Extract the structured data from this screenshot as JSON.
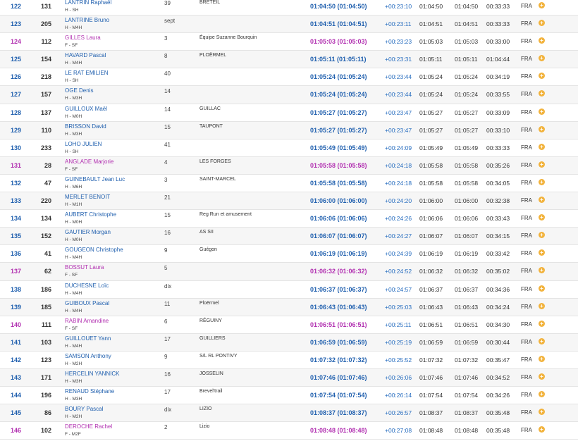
{
  "colors": {
    "male": "#1f5fae",
    "female": "#b12fb0",
    "gap": "#2a6fc0",
    "add_button": "#f2b33d"
  },
  "add_icon": "plus-circle-icon",
  "rows": [
    {
      "rank": "122",
      "bib": "131",
      "name": "LANTRIN Raphaël",
      "cat": "H - SH",
      "age": "39",
      "club": "BRETEIL",
      "time": "01:04:50 (01:04:50)",
      "gap": "+00:23:10",
      "t1": "01:04:50",
      "t2": "01:04:50",
      "t3": "00:33:33",
      "nat": "FRA",
      "sex": "m",
      "add": "+"
    },
    {
      "rank": "123",
      "bib": "205",
      "name": "LANTRINE Bruno",
      "cat": "H - M4H",
      "age": "sept",
      "club": "",
      "time": "01:04:51 (01:04:51)",
      "gap": "+00:23:11",
      "t1": "01:04:51",
      "t2": "01:04:51",
      "t3": "00:33:33",
      "nat": "FRA",
      "sex": "m",
      "add": "+"
    },
    {
      "rank": "124",
      "bib": "112",
      "name": "GILLES Laura",
      "cat": "F - SF",
      "age": "3",
      "club": "Équipe Suzanne Bourquin",
      "time": "01:05:03 (01:05:03)",
      "gap": "+00:23:23",
      "t1": "01:05:03",
      "t2": "01:05:03",
      "t3": "00:33:00",
      "nat": "FRA",
      "sex": "f",
      "add": "+"
    },
    {
      "rank": "125",
      "bib": "154",
      "name": "HAVARD Pascal",
      "cat": "H - M4H",
      "age": "8",
      "club": "PLOËRMEL",
      "time": "01:05:11 (01:05:11)",
      "gap": "+00:23:31",
      "t1": "01:05:11",
      "t2": "01:05:11",
      "t3": "01:04:44",
      "nat": "FRA",
      "sex": "m",
      "add": "+"
    },
    {
      "rank": "126",
      "bib": "218",
      "name": "LE RAT EMILIEN",
      "cat": "H - SH",
      "age": "40",
      "club": "",
      "time": "01:05:24 (01:05:24)",
      "gap": "+00:23:44",
      "t1": "01:05:24",
      "t2": "01:05:24",
      "t3": "00:34:19",
      "nat": "FRA",
      "sex": "m",
      "add": "+"
    },
    {
      "rank": "127",
      "bib": "157",
      "name": "OGE Denis",
      "cat": "H - M3H",
      "age": "14",
      "club": "",
      "time": "01:05:24 (01:05:24)",
      "gap": "+00:23:44",
      "t1": "01:05:24",
      "t2": "01:05:24",
      "t3": "00:33:55",
      "nat": "FRA",
      "sex": "m",
      "add": "+"
    },
    {
      "rank": "128",
      "bib": "137",
      "name": "GUILLOUX Maël",
      "cat": "H - M0H",
      "age": "14",
      "club": "GUILLAC",
      "time": "01:05:27 (01:05:27)",
      "gap": "+00:23:47",
      "t1": "01:05:27",
      "t2": "01:05:27",
      "t3": "00:33:09",
      "nat": "FRA",
      "sex": "m",
      "add": "+"
    },
    {
      "rank": "129",
      "bib": "110",
      "name": "BRISSON David",
      "cat": "H - M3H",
      "age": "15",
      "club": "TAUPONT",
      "time": "01:05:27 (01:05:27)",
      "gap": "+00:23:47",
      "t1": "01:05:27",
      "t2": "01:05:27",
      "t3": "00:33:10",
      "nat": "FRA",
      "sex": "m",
      "add": "+"
    },
    {
      "rank": "130",
      "bib": "233",
      "name": "LOHO JULIEN",
      "cat": "H - SH",
      "age": "41",
      "club": "",
      "time": "01:05:49 (01:05:49)",
      "gap": "+00:24:09",
      "t1": "01:05:49",
      "t2": "01:05:49",
      "t3": "00:33:33",
      "nat": "FRA",
      "sex": "m",
      "add": "+"
    },
    {
      "rank": "131",
      "bib": "28",
      "name": "ANGLADE Marjorie",
      "cat": "F - SF",
      "age": "4",
      "club": "LES FORGES",
      "time": "01:05:58 (01:05:58)",
      "gap": "+00:24:18",
      "t1": "01:05:58",
      "t2": "01:05:58",
      "t3": "00:35:26",
      "nat": "FRA",
      "sex": "f",
      "add": "+"
    },
    {
      "rank": "132",
      "bib": "47",
      "name": "GUINEBAULT Jean Luc",
      "cat": "H - M6H",
      "age": "3",
      "club": "SAINT-MARCEL",
      "time": "01:05:58 (01:05:58)",
      "gap": "+00:24:18",
      "t1": "01:05:58",
      "t2": "01:05:58",
      "t3": "00:34:05",
      "nat": "FRA",
      "sex": "m",
      "add": "+"
    },
    {
      "rank": "133",
      "bib": "220",
      "name": "MERLET BENOIT",
      "cat": "H - M1H",
      "age": "21",
      "club": "",
      "time": "01:06:00 (01:06:00)",
      "gap": "+00:24:20",
      "t1": "01:06:00",
      "t2": "01:06:00",
      "t3": "00:32:38",
      "nat": "FRA",
      "sex": "m",
      "add": "+"
    },
    {
      "rank": "134",
      "bib": "134",
      "name": "AUBERT Christophe",
      "cat": "H - M0H",
      "age": "15",
      "club": "Reg Run et amusement",
      "time": "01:06:06 (01:06:06)",
      "gap": "+00:24:26",
      "t1": "01:06:06",
      "t2": "01:06:06",
      "t3": "00:33:43",
      "nat": "FRA",
      "sex": "m",
      "add": "+"
    },
    {
      "rank": "135",
      "bib": "152",
      "name": "GAUTIER Morgan",
      "cat": "H - M0H",
      "age": "16",
      "club": "AS SII",
      "time": "01:06:07 (01:06:07)",
      "gap": "+00:24:27",
      "t1": "01:06:07",
      "t2": "01:06:07",
      "t3": "00:34:15",
      "nat": "FRA",
      "sex": "m",
      "add": "+"
    },
    {
      "rank": "136",
      "bib": "41",
      "name": "GOUGEON Christophe",
      "cat": "H - M4H",
      "age": "9",
      "club": "Guégon",
      "time": "01:06:19 (01:06:19)",
      "gap": "+00:24:39",
      "t1": "01:06:19",
      "t2": "01:06:19",
      "t3": "00:33:42",
      "nat": "FRA",
      "sex": "m",
      "add": "+"
    },
    {
      "rank": "137",
      "bib": "62",
      "name": "BOSSUT Laura",
      "cat": "F - SF",
      "age": "5",
      "club": "",
      "time": "01:06:32 (01:06:32)",
      "gap": "+00:24:52",
      "t1": "01:06:32",
      "t2": "01:06:32",
      "t3": "00:35:02",
      "nat": "FRA",
      "sex": "f",
      "add": "+"
    },
    {
      "rank": "138",
      "bib": "186",
      "name": "DUCHESNE Loïc",
      "cat": "H - M4H",
      "age": "dix",
      "club": "",
      "time": "01:06:37 (01:06:37)",
      "gap": "+00:24:57",
      "t1": "01:06:37",
      "t2": "01:06:37",
      "t3": "00:34:36",
      "nat": "FRA",
      "sex": "m",
      "add": "+"
    },
    {
      "rank": "139",
      "bib": "185",
      "name": "GUIBOUX Pascal",
      "cat": "H - M4H",
      "age": "11",
      "club": "Ploërmel",
      "time": "01:06:43 (01:06:43)",
      "gap": "+00:25:03",
      "t1": "01:06:43",
      "t2": "01:06:43",
      "t3": "00:34:24",
      "nat": "FRA",
      "sex": "m",
      "add": "+"
    },
    {
      "rank": "140",
      "bib": "111",
      "name": "RABIN Amandine",
      "cat": "F - SF",
      "age": "6",
      "club": "RÉGUINY",
      "time": "01:06:51 (01:06:51)",
      "gap": "+00:25:11",
      "t1": "01:06:51",
      "t2": "01:06:51",
      "t3": "00:34:30",
      "nat": "FRA",
      "sex": "f",
      "add": "+"
    },
    {
      "rank": "141",
      "bib": "103",
      "name": "GUILLOUET Yann",
      "cat": "H - M4H",
      "age": "17",
      "club": "GUILLIERS",
      "time": "01:06:59 (01:06:59)",
      "gap": "+00:25:19",
      "t1": "01:06:59",
      "t2": "01:06:59",
      "t3": "00:30:44",
      "nat": "FRA",
      "sex": "m",
      "add": "+"
    },
    {
      "rank": "142",
      "bib": "123",
      "name": "SAMSON Anthony",
      "cat": "H - M2H",
      "age": "9",
      "club": "S/L RL PONTIVY",
      "time": "01:07:32 (01:07:32)",
      "gap": "+00:25:52",
      "t1": "01:07:32",
      "t2": "01:07:32",
      "t3": "00:35:47",
      "nat": "FRA",
      "sex": "m",
      "add": "+"
    },
    {
      "rank": "143",
      "bib": "171",
      "name": "HERCELIN YANNICK",
      "cat": "H - M3H",
      "age": "16",
      "club": "JOSSELIN",
      "time": "01:07:46 (01:07:46)",
      "gap": "+00:26:06",
      "t1": "01:07:46",
      "t2": "01:07:46",
      "t3": "00:34:52",
      "nat": "FRA",
      "sex": "m",
      "add": "+"
    },
    {
      "rank": "144",
      "bib": "196",
      "name": "RENAUD Stéphane",
      "cat": "H - M3H",
      "age": "17",
      "club": "Brevel'trail",
      "time": "01:07:54 (01:07:54)",
      "gap": "+00:26:14",
      "t1": "01:07:54",
      "t2": "01:07:54",
      "t3": "00:34:26",
      "nat": "FRA",
      "sex": "m",
      "add": "+"
    },
    {
      "rank": "145",
      "bib": "86",
      "name": "BOURY Pascal",
      "cat": "H - M2H",
      "age": "dix",
      "club": "LIZIO",
      "time": "01:08:37 (01:08:37)",
      "gap": "+00:26:57",
      "t1": "01:08:37",
      "t2": "01:08:37",
      "t3": "00:35:48",
      "nat": "FRA",
      "sex": "m",
      "add": "+"
    },
    {
      "rank": "146",
      "bib": "102",
      "name": "DEROCHE Rachel",
      "cat": "F - M2F",
      "age": "2",
      "club": "Lizio",
      "time": "01:08:48 (01:08:48)",
      "gap": "+00:27:08",
      "t1": "01:08:48",
      "t2": "01:08:48",
      "t3": "00:35:48",
      "nat": "FRA",
      "sex": "f",
      "add": "+"
    }
  ]
}
